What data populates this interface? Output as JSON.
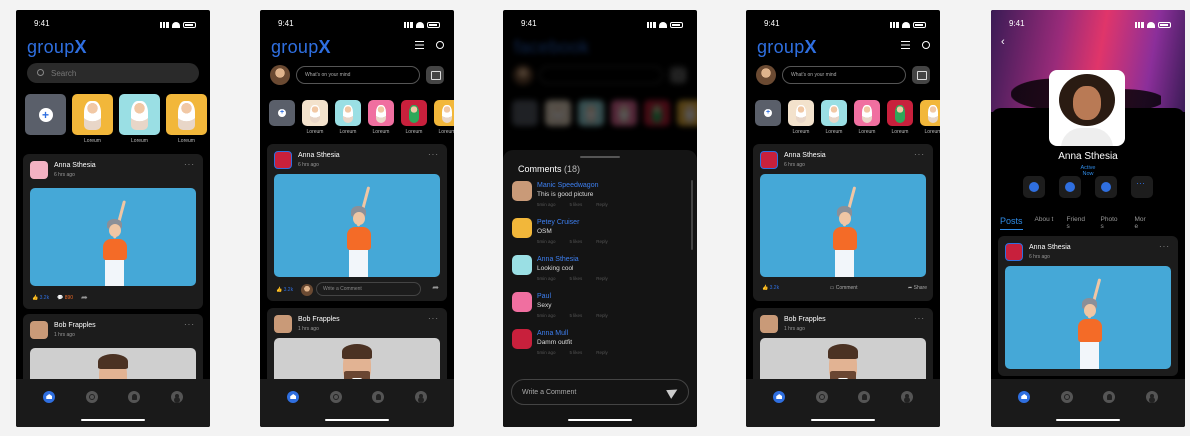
{
  "status_time": "9:41",
  "brand": {
    "prefix": "group",
    "suffix": "X"
  },
  "search_placeholder": "Search",
  "mind_placeholder": "What's on your mind",
  "story_label": "Loreum",
  "story_colors": {
    "yellow": "#f2b73a",
    "teal": "#9adfe4",
    "pink": "#f06fa0",
    "red": "#c8203c",
    "beige": "#f3e2cc"
  },
  "posts": [
    {
      "name": "Anna Sthesia",
      "time": "6 hrs ago",
      "likes": "3.2k",
      "loves": "890",
      "likes_alt": "3.2k"
    },
    {
      "name": "Bob Frapples",
      "time": "1 hrs ago"
    }
  ],
  "write_comment_placeholder": "Write a Comment",
  "comment_action": "Comment",
  "share_action": "Share",
  "blur_brand": "facebook",
  "comments_sheet": {
    "title": "Comments",
    "count": "(18)",
    "items": [
      {
        "name": "Manic Speedwagon",
        "text": "This is good picture",
        "time": "5min ago",
        "likes": "5 likes",
        "reply": "Reply"
      },
      {
        "name": "Petey Cruiser",
        "text": "OSM",
        "time": "5min ago",
        "likes": "5 likes",
        "reply": "Reply"
      },
      {
        "name": "Anna Sthesia",
        "text": "Looking cool",
        "time": "5min ago",
        "likes": "5 likes",
        "reply": "Reply"
      },
      {
        "name": "Paul",
        "text": "Sexy",
        "time": "5min ago",
        "likes": "5 likes",
        "reply": "Reply"
      },
      {
        "name": "Anna Mull",
        "text": "Damm outfit",
        "time": "5min ago",
        "likes": "5 likes",
        "reply": "Reply"
      }
    ],
    "input_placeholder": "Write a Comment"
  },
  "profile": {
    "name": "Anna Sthesia",
    "status_line1": "Active",
    "status_line2": "Now",
    "tabs": [
      "Posts",
      "Abou t",
      "Friend s",
      "Photo s",
      "Mor e"
    ]
  },
  "accent": "#2f6fe0"
}
